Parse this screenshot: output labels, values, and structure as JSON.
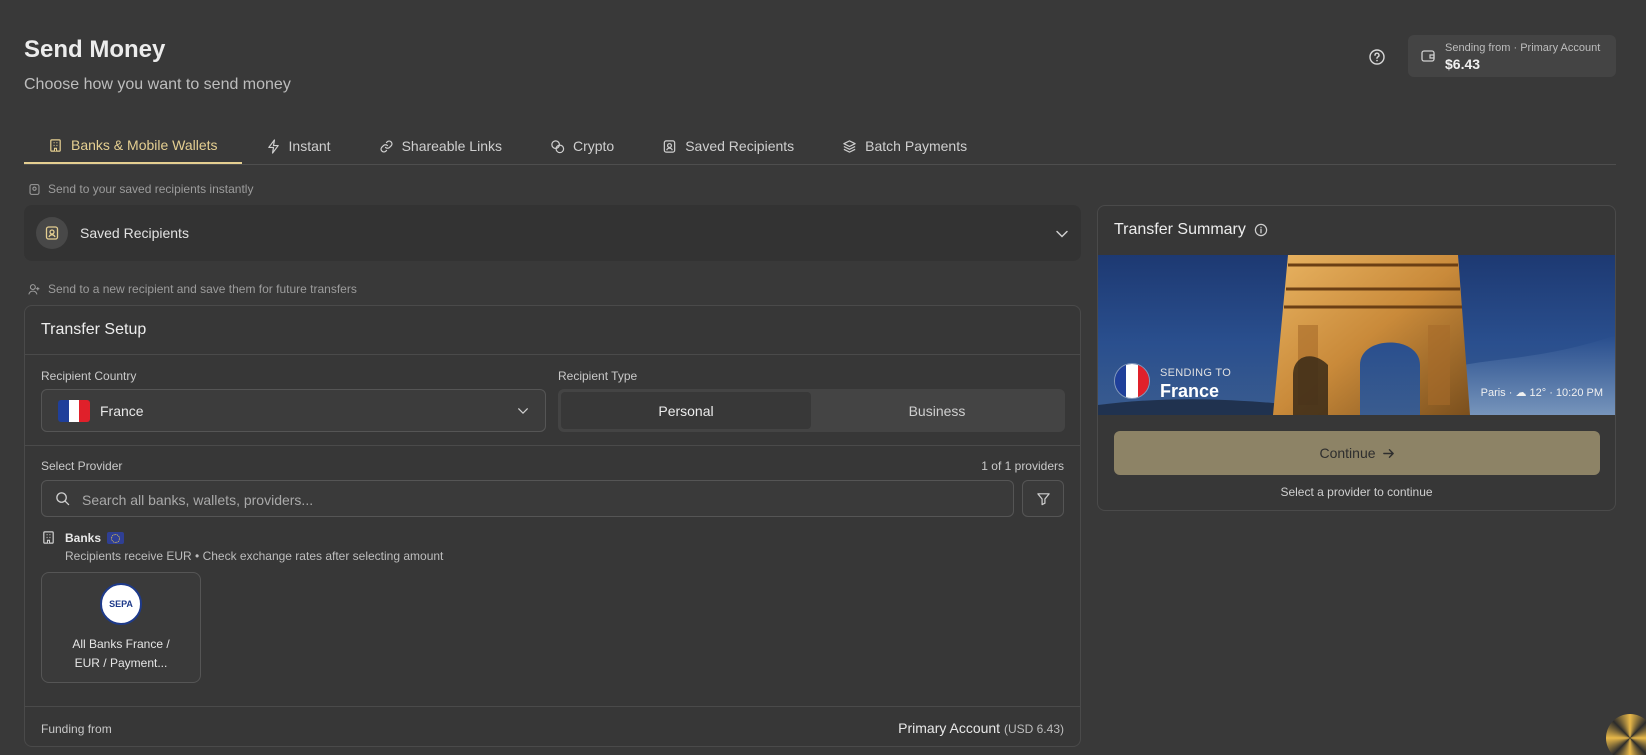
{
  "header": {
    "title": "Send Money",
    "subtitle": "Choose how you want to send money",
    "balance_label": "Sending from · Primary Account",
    "balance_amount": "$6.43"
  },
  "tabs": [
    {
      "label": "Banks & Mobile Wallets",
      "icon": "bank-icon",
      "active": true
    },
    {
      "label": "Instant",
      "icon": "lightning-icon"
    },
    {
      "label": "Shareable Links",
      "icon": "link-icon"
    },
    {
      "label": "Crypto",
      "icon": "coins-icon"
    },
    {
      "label": "Saved Recipients",
      "icon": "contact-icon"
    },
    {
      "label": "Batch Payments",
      "icon": "layers-icon"
    }
  ],
  "saved_section": {
    "hint": "Send to your saved recipients instantly",
    "label": "Saved Recipients"
  },
  "new_section": {
    "hint": "Send to a new recipient and save them for future transfers"
  },
  "setup": {
    "title": "Transfer Setup",
    "country_label": "Recipient Country",
    "country_value": "France",
    "type_label": "Recipient Type",
    "type_options": [
      "Personal",
      "Business"
    ],
    "type_selected": "Personal",
    "provider_label": "Select Provider",
    "provider_count": "1 of 1 providers",
    "search_placeholder": "Search all banks, wallets, providers...",
    "group_name": "Banks",
    "group_sub": "Recipients receive EUR • Check exchange rates after selecting amount",
    "provider_logo_text": "SEPA",
    "provider_name_line1": "All Banks France /",
    "provider_name_line2": "EUR / Payment...",
    "funding_label": "Funding from",
    "funding_account": "Primary Account",
    "funding_amount": "(USD 6.43)"
  },
  "summary": {
    "title": "Transfer Summary",
    "sending_to_label": "SENDING TO",
    "country": "France",
    "meta": "Paris · ☁ 12° · 10:20 PM",
    "continue_label": "Continue",
    "note": "Select a provider to continue"
  },
  "colors": {
    "accent": "#e5cf91",
    "background": "#393939",
    "continue_button": "#8d8366"
  }
}
